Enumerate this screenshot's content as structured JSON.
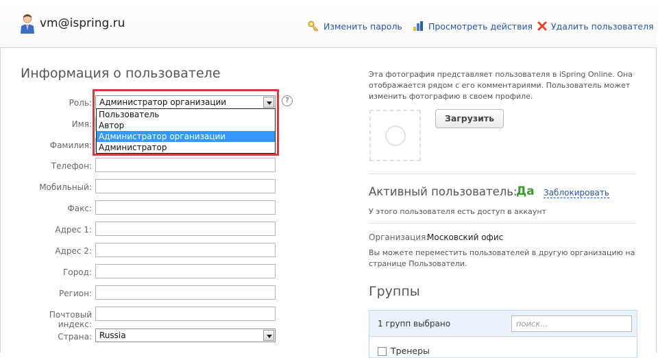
{
  "header": {
    "user_email": "vm@ispring.ru",
    "links": {
      "change_password": "Изменить пароль",
      "view_actions": "Просмотреть действия",
      "delete_user": "Удалить пользователя"
    }
  },
  "form": {
    "title": "Информация о пользователе",
    "labels": {
      "role": "Роль:",
      "first_name": "Имя:",
      "last_name": "Фамилия:",
      "phone": "Телефон:",
      "mobile": "Мобильный:",
      "fax": "Факс:",
      "address1": "Адрес 1:",
      "address2": "Адрес 2:",
      "city": "Город:",
      "region": "Регион:",
      "postal_code": "Почтовый индекс:",
      "country": "Страна:"
    },
    "role_selected": "Администратор организации",
    "role_options": [
      "Пользователь",
      "Автор",
      "Администратор организации",
      "Администратор"
    ],
    "country_selected": "Russia",
    "help": "?"
  },
  "photo": {
    "note": "Эта фотография представляет пользователя в iSpring Online. Она отображается рядом с его комментариями. Пользователь может изменить фотографию в своем профиле.",
    "upload_label": "Загрузить"
  },
  "status": {
    "active_label": "Активный пользователь:",
    "active_value": "Да",
    "block_link": "Заблокировать",
    "access_note": "У этого пользователя есть доступ в аккаунт"
  },
  "organization": {
    "label": "Организация:",
    "value": "Московский офис",
    "note": "Вы можете переместить пользователей в другую организацию на странице Пользователи."
  },
  "groups": {
    "title": "Группы",
    "selected_count": "1 групп выбрано",
    "search_placeholder": "поиск...",
    "first_item": "Тренеры"
  },
  "colors": {
    "link": "#2457a8",
    "active_green": "#3c9a2c",
    "highlight_red": "#d23c3c",
    "selected_option": "#3399ff"
  }
}
